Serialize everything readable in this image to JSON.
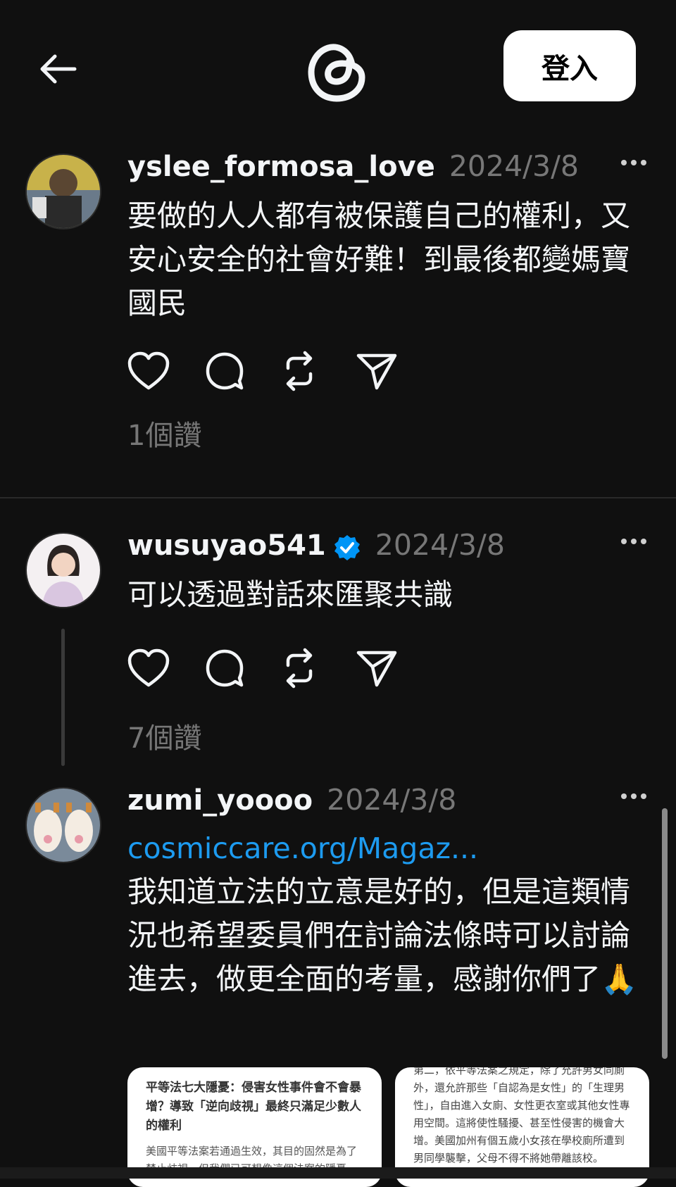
{
  "header": {
    "back_icon": "arrow-left-icon",
    "logo_icon": "threads-logo-icon",
    "login_label": "登入"
  },
  "posts": [
    {
      "username": "yslee_formosa_love",
      "timestamp": "2024/3/8",
      "verified": false,
      "text": "要做的人人都有被保護自己的權利，又安心安全的社會好難！到最後都變媽寶國民",
      "likes": "1個讚"
    },
    {
      "username": "wusuyao541",
      "timestamp": "2024/3/8",
      "verified": true,
      "text": "可以透過對話來匯聚共識",
      "likes": "7個讚"
    },
    {
      "username": "zumi_yoooo",
      "timestamp": "2024/3/8",
      "verified": false,
      "link": "cosmiccare.org/Magaz...",
      "text": "我知道立法的立意是好的，但是這類情況也希望委員們在討論法條時可以討論進去，做更全面的考量，感謝你們了🙏",
      "cards": [
        {
          "title": "平等法七大隱憂：侵害女性事件會不會暴增？導致「逆向歧視」最終只滿足少數人的權利",
          "body": "美國平等法案若通過生效，其目的固然是為了禁止歧視，但我們已可想像這個法案的隱憂，"
        },
        {
          "body": "第二，依平等法案之規定，除了允許男女同廁外，還允許那些「自認為是女性」的「生理男性」，自由進入女廁、女性更衣室或其他女性專用空間。這將使性騷擾、甚至性侵害的機會大增。美國加州有個五歲小女孩在學校廁所遭到男同學襲擊，父母不得不將她帶離該校。"
        }
      ]
    }
  ],
  "colors": {
    "background": "#101010",
    "text": "#f3f5f7",
    "muted": "#777777",
    "link": "#1d9bf0",
    "verified": "#0095f6"
  }
}
